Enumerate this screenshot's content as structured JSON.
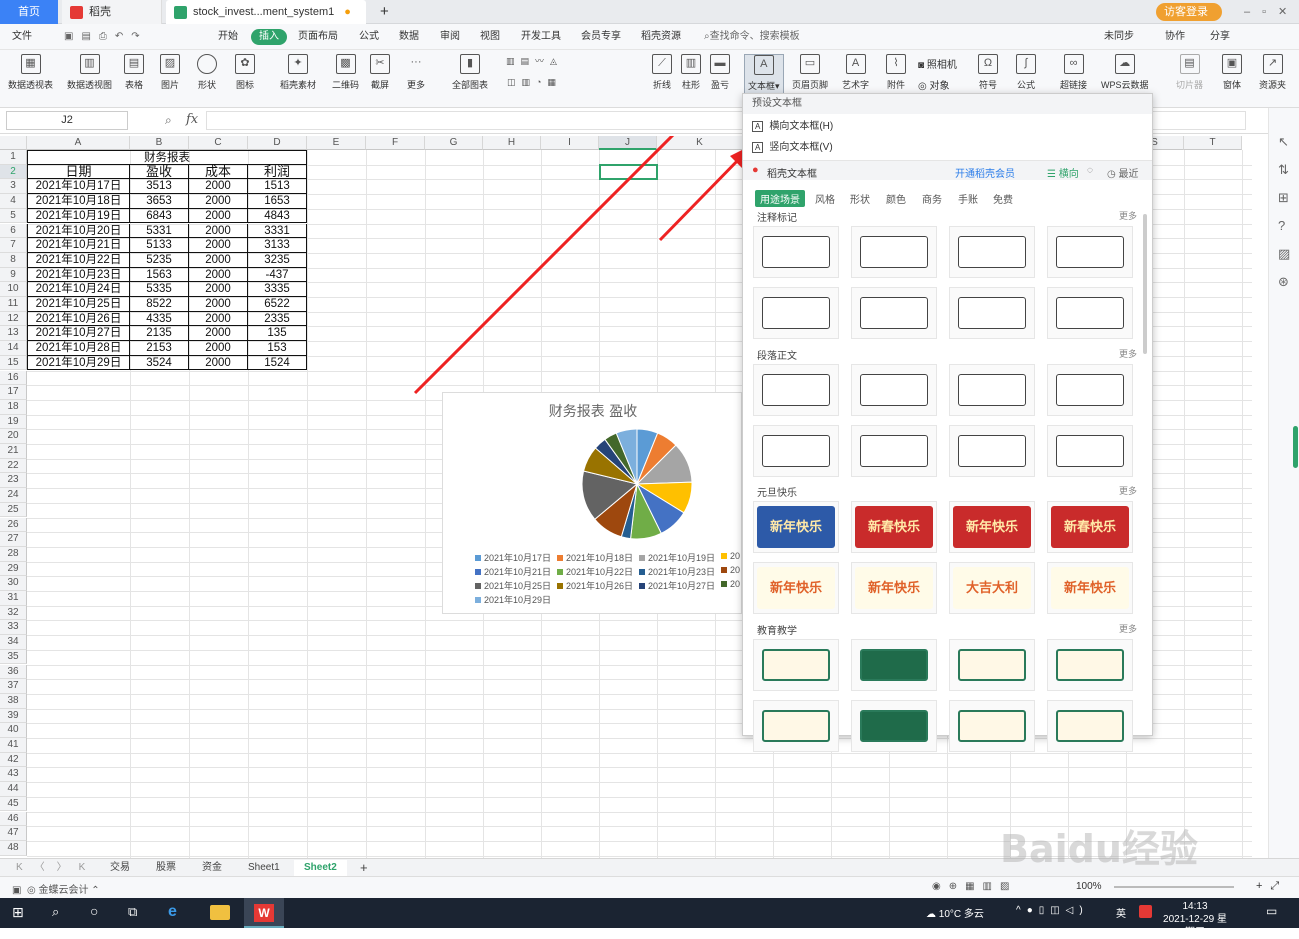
{
  "tabs": {
    "home": "首页",
    "daoke": "稻壳",
    "file": "stock_invest...ment_system1",
    "login": "访客登录"
  },
  "menu": [
    "文件",
    "开始",
    "插入",
    "页面布局",
    "公式",
    "数据",
    "审阅",
    "视图",
    "开发工具",
    "会员专享",
    "稻壳资源"
  ],
  "menu_search": "查找命令、搜索模板",
  "menu_right": [
    "未同步",
    "协作",
    "分享"
  ],
  "ribbon": [
    "数据透视表",
    "数据透视图",
    "表格",
    "图片",
    "形状",
    "图标",
    "稻壳素材",
    "二维码",
    "截屏",
    "更多",
    "全部图表",
    "折线",
    "柱形",
    "盈亏",
    "文本框",
    "页眉页脚",
    "艺术字",
    "附件",
    "对象",
    "符号",
    "公式",
    "超链接",
    "WPS云数据",
    "切片器",
    "窗体",
    "资源夹"
  ],
  "ribbon_extra": [
    "照相机"
  ],
  "namebox": "J2",
  "fx": "fx",
  "columns": [
    "A",
    "B",
    "C",
    "D",
    "E",
    "F",
    "G",
    "H",
    "I",
    "J",
    "K",
    "S",
    "T"
  ],
  "sheet_title": "财务报表",
  "headers": [
    "日期",
    "盈收",
    "成本",
    "利润"
  ],
  "rows": [
    [
      "2021年10月17日",
      "3513",
      "2000",
      "1513"
    ],
    [
      "2021年10月18日",
      "3653",
      "2000",
      "1653"
    ],
    [
      "2021年10月19日",
      "6843",
      "2000",
      "4843"
    ],
    [
      "2021年10月20日",
      "5331",
      "2000",
      "3331"
    ],
    [
      "2021年10月21日",
      "5133",
      "2000",
      "3133"
    ],
    [
      "2021年10月22日",
      "5235",
      "2000",
      "3235"
    ],
    [
      "2021年10月23日",
      "1563",
      "2000",
      "-437"
    ],
    [
      "2021年10月24日",
      "5335",
      "2000",
      "3335"
    ],
    [
      "2021年10月25日",
      "8522",
      "2000",
      "6522"
    ],
    [
      "2021年10月26日",
      "4335",
      "2000",
      "2335"
    ],
    [
      "2021年10月27日",
      "2135",
      "2000",
      "135"
    ],
    [
      "2021年10月28日",
      "2153",
      "2000",
      "153"
    ],
    [
      "2021年10月29日",
      "3524",
      "2000",
      "1524"
    ]
  ],
  "chart_data": {
    "type": "pie",
    "title": "财务报表 盈收",
    "categories": [
      "2021年10月17日",
      "2021年10月18日",
      "2021年10月19日",
      "2021年10月20日",
      "2021年10月21日",
      "2021年10月22日",
      "2021年10月23日",
      "2021年10月24日",
      "2021年10月25日",
      "2021年10月26日",
      "2021年10月27日",
      "2021年10月28日",
      "2021年10月29日"
    ],
    "values": [
      3513,
      3653,
      6843,
      5331,
      5133,
      5235,
      1563,
      5335,
      8522,
      4335,
      2135,
      2153,
      3524
    ],
    "colors": [
      "#5b9bd5",
      "#ed7d31",
      "#a5a5a5",
      "#ffc000",
      "#4472c4",
      "#70ad47",
      "#255e91",
      "#9e480e",
      "#636363",
      "#997300",
      "#264478",
      "#43682b",
      "#7cafdd"
    ],
    "legend": "bottom",
    "legend_labels": [
      "2021年10月17日",
      "2021年10月18日",
      "2021年10月19日",
      "20",
      "2021年10月21日",
      "2021年10月22日",
      "2021年10月23日",
      "20",
      "2021年10月25日",
      "2021年10月26日",
      "2021年10月27日",
      "20",
      "2021年10月29日"
    ]
  },
  "panel": {
    "preset": "预设文本框",
    "horizontal": "横向文本框(H)",
    "vertical": "竖向文本框(V)",
    "daoke": "稻壳文本框",
    "member": "开通稻壳会员",
    "dir": "横向",
    "recent": "最近",
    "filters": [
      "用途场景",
      "风格",
      "形状",
      "颜色",
      "商务",
      "手账",
      "免费"
    ],
    "sections": [
      "注释标记",
      "段落正文",
      "元旦快乐",
      "教育教学"
    ],
    "more": "更多",
    "newyear": [
      "新年快乐",
      "新春快乐",
      "新年快乐",
      "新春快乐",
      "新年快乐",
      "新年快乐",
      "大吉大利",
      "新年快乐"
    ]
  },
  "sheets": [
    "交易",
    "股票",
    "资金",
    "Sheet1",
    "Sheet2"
  ],
  "status": {
    "left": "金蝶云会计",
    "zoom": "100%"
  },
  "taskbar": {
    "weather": "10°C 多云",
    "ime": "英",
    "time": "14:13",
    "date": "2021-12-29 星期三"
  },
  "watermark": "Baidu经验"
}
